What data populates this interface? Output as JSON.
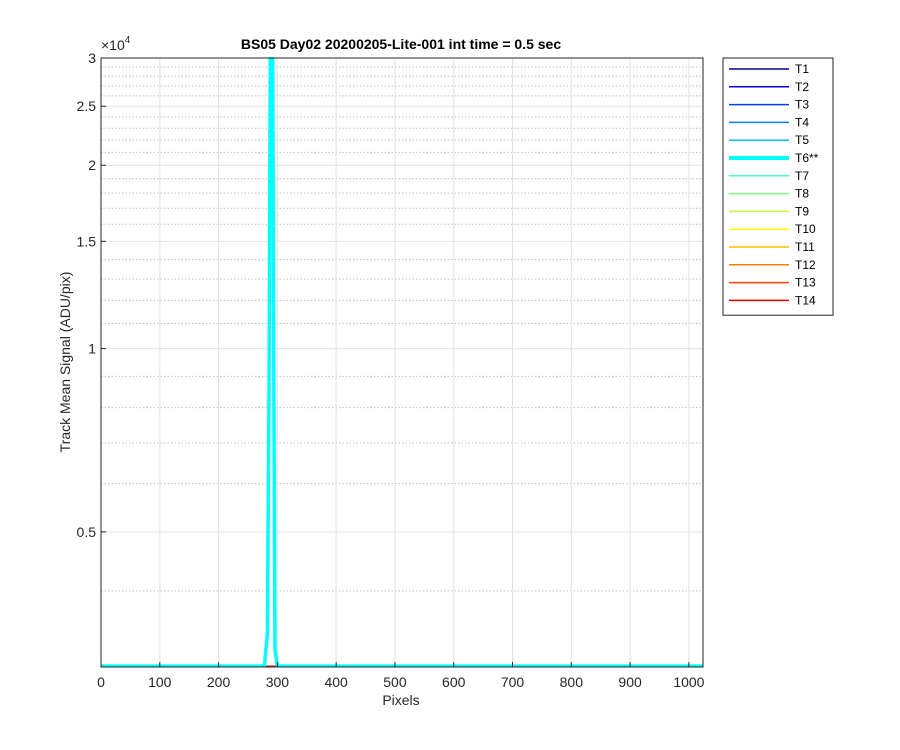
{
  "chart_data": {
    "type": "line",
    "title": "BS05 Day02 20200205-Lite-001 int time = 0.5 sec",
    "xlabel": "Pixels",
    "ylabel": "Track Mean Signal (ADU/pix)",
    "y_exponent_label": "×10",
    "y_exponent_power": "4",
    "xlim": [
      0,
      1024
    ],
    "ylim": [
      3000,
      30000
    ],
    "yscale": "log",
    "grid": true,
    "minor_grid": true,
    "legend_location": "outside-right",
    "x_ticks": [
      {
        "value": 0,
        "label": "0"
      },
      {
        "value": 100,
        "label": "100"
      },
      {
        "value": 200,
        "label": "200"
      },
      {
        "value": 300,
        "label": "300"
      },
      {
        "value": 400,
        "label": "400"
      },
      {
        "value": 500,
        "label": "500"
      },
      {
        "value": 600,
        "label": "600"
      },
      {
        "value": 700,
        "label": "700"
      },
      {
        "value": 800,
        "label": "800"
      },
      {
        "value": 900,
        "label": "900"
      },
      {
        "value": 1000,
        "label": "1000"
      }
    ],
    "y_ticks": [
      {
        "value": 5000,
        "label": "0.5"
      },
      {
        "value": 10000,
        "label": "1"
      },
      {
        "value": 15000,
        "label": "1.5"
      },
      {
        "value": 20000,
        "label": "2"
      },
      {
        "value": 25000,
        "label": "2.5"
      },
      {
        "value": 30000,
        "label": "3"
      }
    ],
    "series": [
      {
        "name": "T1",
        "color": "#00008F",
        "x": [
          0,
          1024
        ],
        "y": [
          3010,
          3010
        ]
      },
      {
        "name": "T2",
        "color": "#0000E0",
        "x": [
          0,
          1024
        ],
        "y": [
          3010,
          3010
        ]
      },
      {
        "name": "T3",
        "color": "#0040FF",
        "x": [
          0,
          1024
        ],
        "y": [
          3010,
          3010
        ]
      },
      {
        "name": "T4",
        "color": "#0080FF",
        "x": [
          0,
          1024
        ],
        "y": [
          3010,
          3010
        ]
      },
      {
        "name": "T5",
        "color": "#00BFFF",
        "x": [
          0,
          1024
        ],
        "y": [
          3010,
          3010
        ]
      },
      {
        "name": "T6**",
        "color": "#00FFFF",
        "bold": true,
        "x": [
          0,
          278,
          283,
          286,
          288,
          290,
          292,
          294,
          296,
          300,
          1024
        ],
        "y": [
          3010,
          3010,
          3400,
          9000,
          30000,
          30000,
          30000,
          9000,
          3200,
          3010,
          3010
        ]
      },
      {
        "name": "T7",
        "color": "#40FFBF",
        "x": [
          0,
          1024
        ],
        "y": [
          3010,
          3010
        ]
      },
      {
        "name": "T8",
        "color": "#80FF80",
        "x": [
          0,
          1024
        ],
        "y": [
          3010,
          3010
        ]
      },
      {
        "name": "T9",
        "color": "#BFFF40",
        "x": [
          0,
          1024
        ],
        "y": [
          3010,
          3010
        ]
      },
      {
        "name": "T10",
        "color": "#FFFF00",
        "x": [
          0,
          1024
        ],
        "y": [
          3010,
          3010
        ]
      },
      {
        "name": "T11",
        "color": "#FFBF00",
        "x": [
          0,
          1024
        ],
        "y": [
          3010,
          3010
        ]
      },
      {
        "name": "T12",
        "color": "#FF8000",
        "x": [
          0,
          1024
        ],
        "y": [
          3010,
          3010
        ]
      },
      {
        "name": "T13",
        "color": "#FF4000",
        "x": [
          0,
          1024
        ],
        "y": [
          3010,
          3010
        ]
      },
      {
        "name": "T14",
        "color": "#E00000",
        "x": [
          0,
          1024
        ],
        "y": [
          3010,
          3010
        ]
      }
    ]
  }
}
